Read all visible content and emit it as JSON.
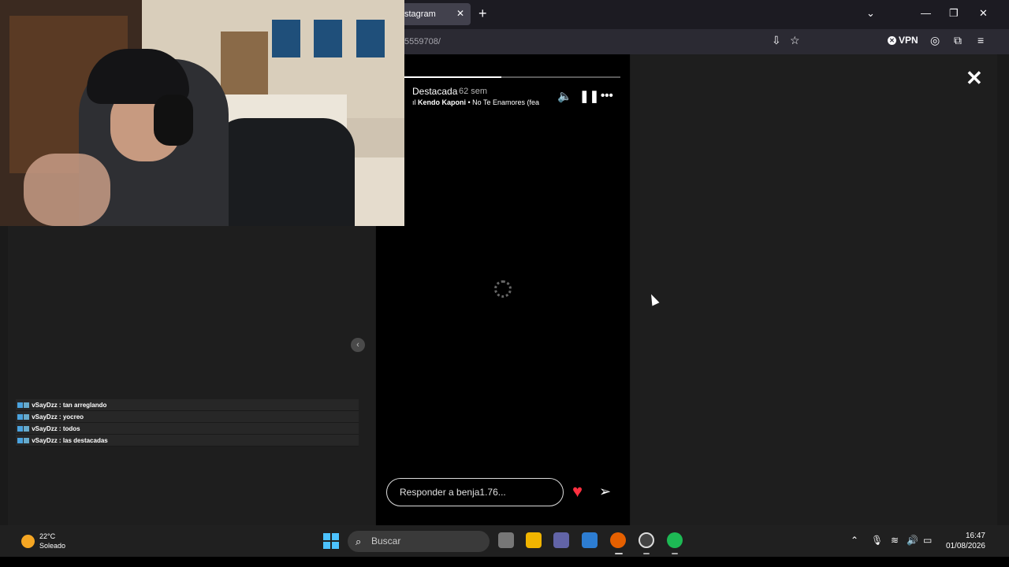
{
  "browser": {
    "tab_title": "stagram",
    "tab_close": "✕",
    "new_tab": "+",
    "url": "5559708/",
    "vpn_label": "VPN"
  },
  "story": {
    "title": "Destacada",
    "age": "62 sem",
    "music_artist": "Kendo Kaponi",
    "music_track": " • No Te Enamores (fea",
    "progress": 0.45,
    "reply_placeholder": "Responder a benja1.76..."
  },
  "chat": [
    {
      "user": "vSayDzz",
      "message": "tan arreglando"
    },
    {
      "user": "vSayDzz",
      "message": "yocreo"
    },
    {
      "user": "vSayDzz",
      "message": "todos"
    },
    {
      "user": "vSayDzz",
      "message": "las destacadas"
    }
  ],
  "taskbar": {
    "temperature": "22°C",
    "condition": "Soleado",
    "search_label": "Buscar",
    "time": "16:47",
    "date": "01/08/2026"
  },
  "colors": {
    "heart": "#ff3040",
    "browser_bg": "#1c1b22",
    "taskbar_bg": "#202020"
  }
}
